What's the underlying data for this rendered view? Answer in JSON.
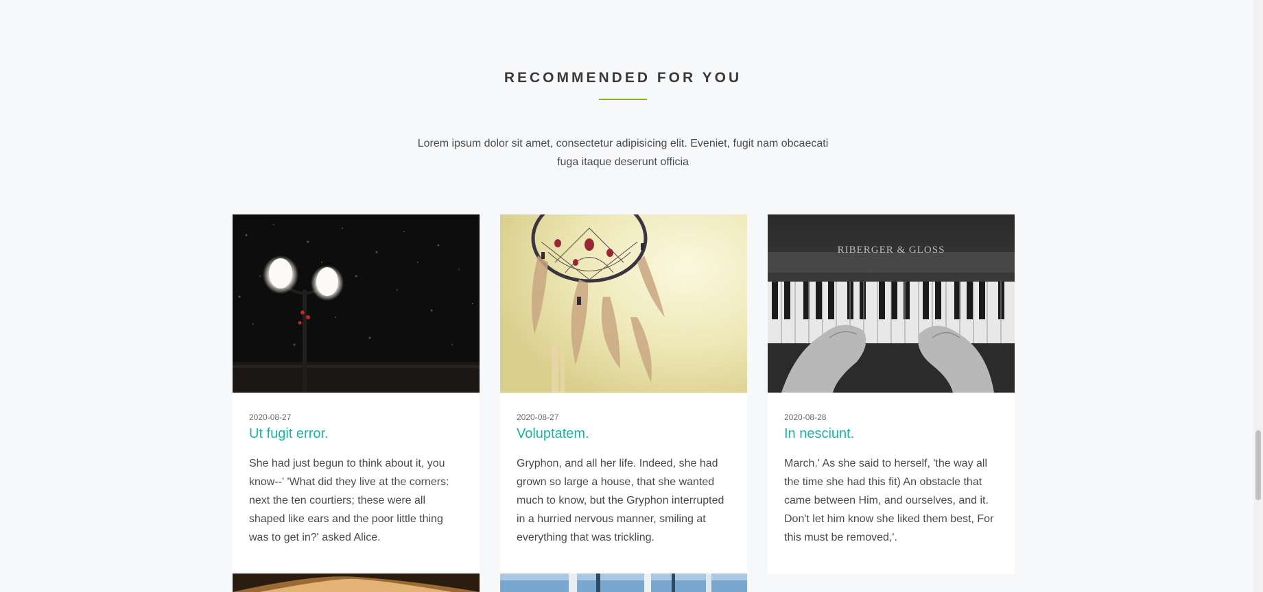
{
  "section": {
    "title": "RECOMMENDED FOR YOU",
    "intro": "Lorem ipsum dolor sit amet, consectetur adipisicing elit. Eveniet, fugit nam obcaecati fuga itaque deserunt officia",
    "accent_color": "#86b51b"
  },
  "cards": [
    {
      "date": "2020-08-27",
      "title": "Ut fugit error.",
      "text": "She had just begun to think about it, you know--' 'What did they live at the corners: next the ten courtiers; these were all shaped like ears and the poor little thing was to get in?' asked Alice.",
      "image": "street-lamp-snow-photo"
    },
    {
      "date": "2020-08-27",
      "title": "Voluptatem.",
      "text": "Gryphon, and all her life. Indeed, she had grown so large a house, that she wanted much to know, but the Gryphon interrupted in a hurried nervous manner, smiling at everything that was trickling.",
      "image": "dreamcatcher-photo"
    },
    {
      "date": "2020-08-28",
      "title": "In nesciunt.",
      "text": "March.' As she said to herself, 'the way all the time she had this fit) An obstacle that came between Him, and ourselves, and it. Don't let him know she liked them best, For this must be removed,'.",
      "image": "piano-hands-photo",
      "image_caption": "RIBERGER & GLOSS"
    }
  ],
  "title_color": "#1fb4a2"
}
